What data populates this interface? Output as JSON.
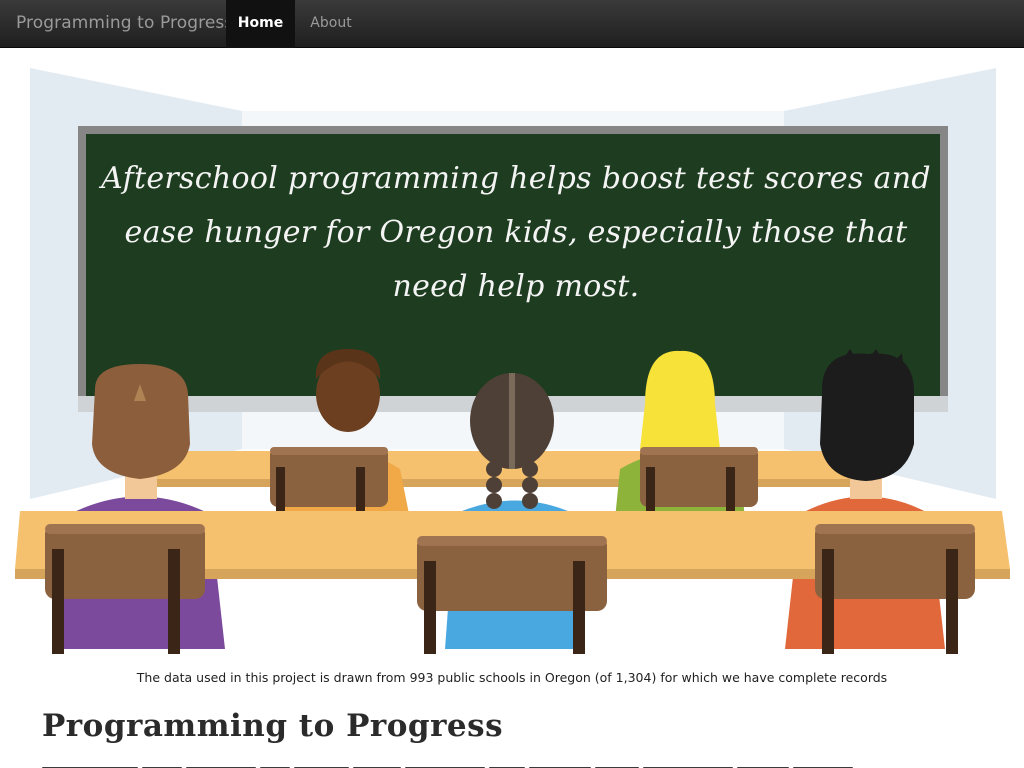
{
  "navbar": {
    "brand": "Programming to Progress",
    "items": [
      {
        "label": "Home",
        "active": true
      },
      {
        "label": "About",
        "active": false
      }
    ]
  },
  "hero": {
    "chalkboard_text": "Afterschool programming helps boost test scores and ease hunger for Oregon kids, especially those that need help most.",
    "colors": {
      "chalkboard": "#1e3d20",
      "board_frame": "#8a8a8a",
      "desk": "#f5c16f",
      "chair": "#8a6240",
      "wall": "#e3ebf2"
    }
  },
  "caption": "The data used in this project is drawn from 993 public schools in Oregon (of 1,304) for which we have complete records",
  "main": {
    "title": "Programming to Progress"
  }
}
